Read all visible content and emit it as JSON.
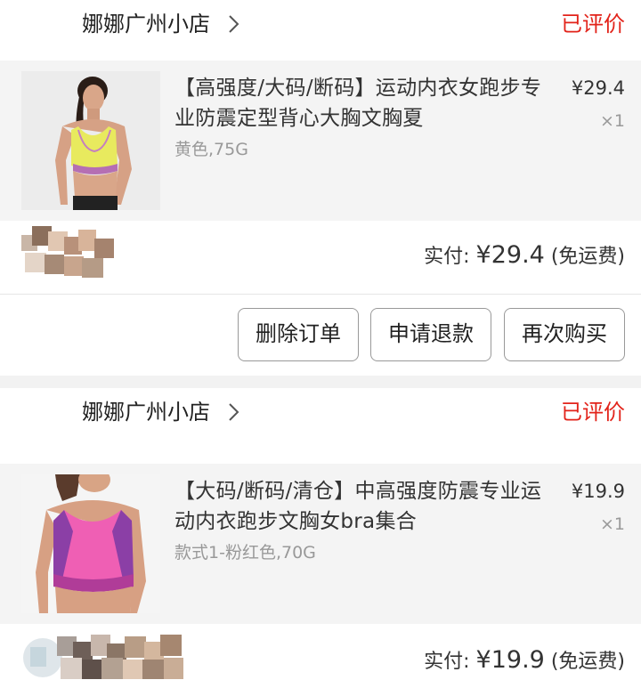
{
  "orders": [
    {
      "shop_name": "娜娜广州小店",
      "status": "已评价",
      "item": {
        "title": "【高强度/大码/断码】运动内衣女跑步专业防震定型背心大胸文胸夏",
        "variant": "黄色,75G",
        "price": "¥29.4",
        "quantity": "×1"
      },
      "paid": {
        "label": "实付: ",
        "amount": "¥29.4",
        "shipping": " (免运费)"
      },
      "buttons": [
        "删除订单",
        "申请退款",
        "再次购买"
      ]
    },
    {
      "shop_name": "娜娜广州小店",
      "status": "已评价",
      "item": {
        "title": "【大码/断码/清仓】中高强度防震专业运动内衣跑步文胸女bra集合",
        "variant": "款式1-粉红色,70G",
        "price": "¥19.9",
        "quantity": "×1"
      },
      "paid": {
        "label": "实付: ",
        "amount": "¥19.9",
        "shipping": " (免运费)"
      }
    }
  ],
  "colors": {
    "status_red": "#e2231a",
    "page_bg": "#f2f2f2",
    "item_bg": "#f4f4f4",
    "muted_text": "#999999"
  },
  "icons": {
    "shop_arrow": "chevron-right-icon"
  }
}
